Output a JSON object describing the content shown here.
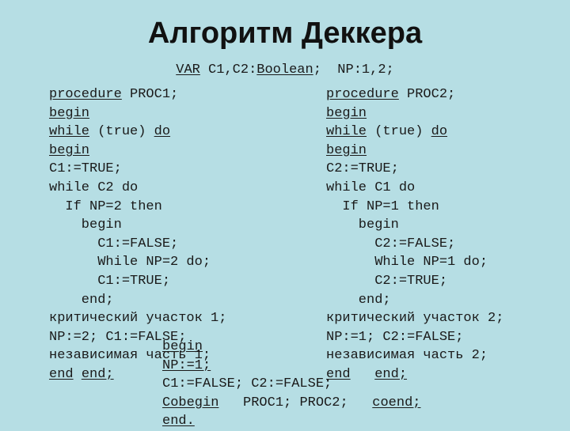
{
  "slide": {
    "title": "Алгоритм Деккера",
    "background_color": "#b6dee4",
    "text_color": "#1a1a1a",
    "declaration_line": {
      "segments": [
        {
          "text": "VAR",
          "underline": true
        },
        {
          "text": " C1,C2:",
          "underline": false
        },
        {
          "text": "Boolean",
          "underline": true
        },
        {
          "text": ";  NP:1,2;",
          "underline": false
        }
      ]
    },
    "left_column": {
      "name": "PROC1",
      "lines": [
        {
          "segments": [
            {
              "text": "procedure",
              "underline": true
            },
            {
              "text": " PROC1;",
              "underline": false
            }
          ]
        },
        {
          "segments": [
            {
              "text": "begin",
              "underline": true
            }
          ]
        },
        {
          "segments": [
            {
              "text": "while",
              "underline": true
            },
            {
              "text": " (true) ",
              "underline": false
            },
            {
              "text": "do",
              "underline": true
            }
          ]
        },
        {
          "segments": [
            {
              "text": "begin",
              "underline": true
            }
          ]
        },
        {
          "segments": [
            {
              "text": "C1:=TRUE;",
              "underline": false
            }
          ]
        },
        {
          "segments": [
            {
              "text": "while C2 do",
              "underline": false
            }
          ]
        },
        {
          "segments": [
            {
              "text": "  If NP=2 then",
              "underline": false
            }
          ]
        },
        {
          "segments": [
            {
              "text": "    begin",
              "underline": false
            }
          ]
        },
        {
          "segments": [
            {
              "text": "      C1:=FALSE;",
              "underline": false
            }
          ]
        },
        {
          "segments": [
            {
              "text": "      While NP=2 do;",
              "underline": false
            }
          ]
        },
        {
          "segments": [
            {
              "text": "      C1:=TRUE;",
              "underline": false
            }
          ]
        },
        {
          "segments": [
            {
              "text": "    end;",
              "underline": false
            }
          ]
        },
        {
          "segments": [
            {
              "text": "критический участок 1;",
              "underline": false
            }
          ]
        },
        {
          "segments": [
            {
              "text": "NP:=2; C1:=FALSE;",
              "underline": false
            }
          ]
        },
        {
          "segments": [
            {
              "text": "независимая часть 1;",
              "underline": false
            }
          ]
        },
        {
          "segments": [
            {
              "text": "end",
              "underline": true
            },
            {
              "text": " ",
              "underline": false
            },
            {
              "text": "end;",
              "underline": true
            }
          ]
        }
      ]
    },
    "right_column": {
      "name": "PROC2",
      "lines": [
        {
          "segments": [
            {
              "text": "procedure",
              "underline": true
            },
            {
              "text": " PROC2;",
              "underline": false
            }
          ]
        },
        {
          "segments": [
            {
              "text": "begin",
              "underline": true
            }
          ]
        },
        {
          "segments": [
            {
              "text": "while",
              "underline": true
            },
            {
              "text": " (true) ",
              "underline": false
            },
            {
              "text": "do",
              "underline": true
            }
          ]
        },
        {
          "segments": [
            {
              "text": "begin",
              "underline": true
            }
          ]
        },
        {
          "segments": [
            {
              "text": "C2:=TRUE;",
              "underline": false
            }
          ]
        },
        {
          "segments": [
            {
              "text": "while C1 do",
              "underline": false
            }
          ]
        },
        {
          "segments": [
            {
              "text": "  If NP=1 then",
              "underline": false
            }
          ]
        },
        {
          "segments": [
            {
              "text": "    begin",
              "underline": false
            }
          ]
        },
        {
          "segments": [
            {
              "text": "      C2:=FALSE;",
              "underline": false
            }
          ]
        },
        {
          "segments": [
            {
              "text": "      While NP=1 do;",
              "underline": false
            }
          ]
        },
        {
          "segments": [
            {
              "text": "      C2:=TRUE;",
              "underline": false
            }
          ]
        },
        {
          "segments": [
            {
              "text": "    end;",
              "underline": false
            }
          ]
        },
        {
          "segments": [
            {
              "text": "критический участок 2;",
              "underline": false
            }
          ]
        },
        {
          "segments": [
            {
              "text": "NP:=1; C2:=FALSE;",
              "underline": false
            }
          ]
        },
        {
          "segments": [
            {
              "text": "независимая часть 2;",
              "underline": false
            }
          ]
        },
        {
          "segments": [
            {
              "text": "end",
              "underline": true
            },
            {
              "text": "   ",
              "underline": false
            },
            {
              "text": "end;",
              "underline": true
            }
          ]
        }
      ]
    },
    "main_block": {
      "lines": [
        {
          "segments": [
            {
              "text": "begin",
              "underline": true
            }
          ]
        },
        {
          "segments": [
            {
              "text": "NP:=1;",
              "underline": true
            }
          ]
        },
        {
          "segments": [
            {
              "text": "C1:=FALSE; C2:=FALSE;",
              "underline": false
            }
          ]
        },
        {
          "segments": [
            {
              "text": "Cobegin",
              "underline": true
            },
            {
              "text": "   PROC1; PROC2;   ",
              "underline": false
            },
            {
              "text": "coend;",
              "underline": true
            }
          ]
        },
        {
          "segments": [
            {
              "text": "end.",
              "underline": true
            }
          ]
        }
      ]
    }
  }
}
